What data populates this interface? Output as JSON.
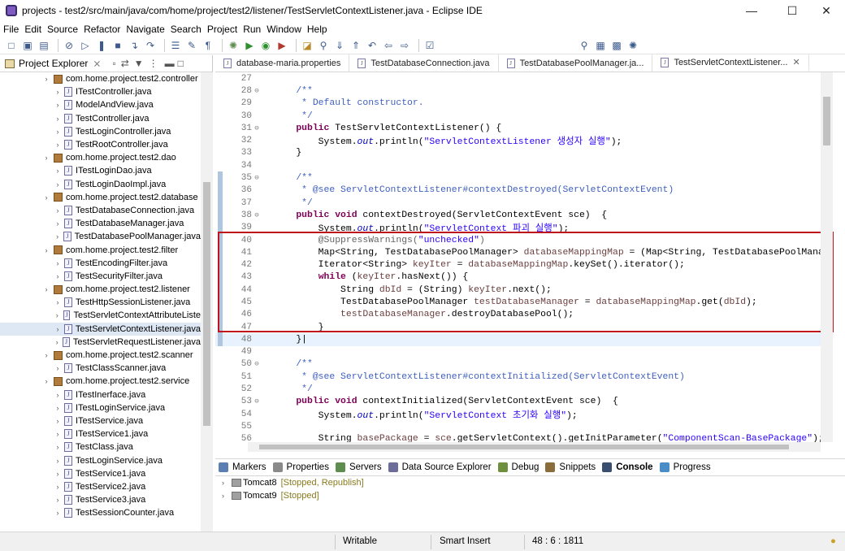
{
  "window": {
    "title": "projects - test2/src/main/java/com/home/project/test2/listener/TestServletContextListener.java - Eclipse IDE"
  },
  "menu": [
    "File",
    "Edit",
    "Source",
    "Refactor",
    "Navigate",
    "Search",
    "Project",
    "Run",
    "Window",
    "Help"
  ],
  "explorer": {
    "title": "Project Explorer",
    "rows": [
      {
        "label": "com.home.project.test2.controller",
        "type": "package",
        "level": 0
      },
      {
        "label": "ITestController.java",
        "type": "file",
        "level": 1
      },
      {
        "label": "ModelAndView.java",
        "type": "file",
        "level": 1
      },
      {
        "label": "TestController.java",
        "type": "file",
        "level": 1
      },
      {
        "label": "TestLoginController.java",
        "type": "file",
        "level": 1
      },
      {
        "label": "TestRootController.java",
        "type": "file",
        "level": 1
      },
      {
        "label": "com.home.project.test2.dao",
        "type": "package",
        "level": 0
      },
      {
        "label": "ITestLoginDao.java",
        "type": "file",
        "level": 1
      },
      {
        "label": "TestLoginDaoImpl.java",
        "type": "file",
        "level": 1
      },
      {
        "label": "com.home.project.test2.database",
        "type": "package",
        "level": 0
      },
      {
        "label": "TestDatabaseConnection.java",
        "type": "file",
        "level": 1
      },
      {
        "label": "TestDatabaseManager.java",
        "type": "file",
        "level": 1
      },
      {
        "label": "TestDatabasePoolManager.java",
        "type": "file",
        "level": 1
      },
      {
        "label": "com.home.project.test2.filter",
        "type": "package",
        "level": 0
      },
      {
        "label": "TestEncodingFilter.java",
        "type": "file",
        "level": 1
      },
      {
        "label": "TestSecurityFilter.java",
        "type": "file",
        "level": 1
      },
      {
        "label": "com.home.project.test2.listener",
        "type": "package",
        "level": 0
      },
      {
        "label": "TestHttpSessionListener.java",
        "type": "file",
        "level": 1
      },
      {
        "label": "TestServletContextAttributeListe",
        "type": "file",
        "level": 1
      },
      {
        "label": "TestServletContextListener.java",
        "type": "file",
        "level": 1,
        "selected": true
      },
      {
        "label": "TestServletRequestListener.java",
        "type": "file",
        "level": 1
      },
      {
        "label": "com.home.project.test2.scanner",
        "type": "package",
        "level": 0
      },
      {
        "label": "TestClassScanner.java",
        "type": "file",
        "level": 1
      },
      {
        "label": "com.home.project.test2.service",
        "type": "package",
        "level": 0
      },
      {
        "label": "ITestInerface.java",
        "type": "file",
        "level": 1
      },
      {
        "label": "ITestLoginService.java",
        "type": "file",
        "level": 1
      },
      {
        "label": "ITestService.java",
        "type": "file",
        "level": 1
      },
      {
        "label": "ITestService1.java",
        "type": "file",
        "level": 1
      },
      {
        "label": "TestClass.java",
        "type": "file",
        "level": 1
      },
      {
        "label": "TestLoginService.java",
        "type": "file",
        "level": 1
      },
      {
        "label": "TestService1.java",
        "type": "file",
        "level": 1
      },
      {
        "label": "TestService2.java",
        "type": "file",
        "level": 1
      },
      {
        "label": "TestService3.java",
        "type": "file",
        "level": 1
      },
      {
        "label": "TestSessionCounter.java",
        "type": "file",
        "level": 1
      }
    ]
  },
  "editor_tabs": [
    {
      "label": "database-maria.properties",
      "active": false
    },
    {
      "label": "TestDatabaseConnection.java",
      "active": false
    },
    {
      "label": "TestDatabasePoolManager.ja...",
      "active": false
    },
    {
      "label": "TestServletContextListener...",
      "active": true
    }
  ],
  "code_lines": [
    {
      "n": "27",
      "marker": false,
      "fold": "",
      "segs": []
    },
    {
      "n": "28",
      "marker": false,
      "fold": "⊖",
      "segs": [
        {
          "c": "cm",
          "t": "    /**"
        }
      ]
    },
    {
      "n": "29",
      "marker": false,
      "fold": "",
      "segs": [
        {
          "c": "cm",
          "t": "     * Default constructor."
        }
      ]
    },
    {
      "n": "30",
      "marker": false,
      "fold": "",
      "segs": [
        {
          "c": "cm",
          "t": "     */"
        }
      ]
    },
    {
      "n": "31",
      "marker": false,
      "fold": "⊖",
      "segs": [
        {
          "c": "",
          "t": "    "
        },
        {
          "c": "kw",
          "t": "public"
        },
        {
          "c": "",
          "t": " TestServletContextListener() {"
        }
      ]
    },
    {
      "n": "32",
      "marker": false,
      "fold": "",
      "segs": [
        {
          "c": "",
          "t": "        System."
        },
        {
          "c": "fi",
          "t": "out"
        },
        {
          "c": "",
          "t": ".println("
        },
        {
          "c": "st",
          "t": "\"ServletContextListener 생성자 실행\""
        },
        {
          "c": "",
          "t": ");"
        }
      ]
    },
    {
      "n": "33",
      "marker": false,
      "fold": "",
      "segs": [
        {
          "c": "",
          "t": "    }"
        }
      ]
    },
    {
      "n": "34",
      "marker": false,
      "fold": "",
      "segs": []
    },
    {
      "n": "35",
      "marker": true,
      "fold": "⊖",
      "segs": [
        {
          "c": "cm",
          "t": "    /**"
        }
      ]
    },
    {
      "n": "36",
      "marker": true,
      "fold": "",
      "segs": [
        {
          "c": "cm",
          "t": "     * @see ServletContextListener#contextDestroyed(ServletContextEvent)"
        }
      ]
    },
    {
      "n": "37",
      "marker": true,
      "fold": "",
      "segs": [
        {
          "c": "cm",
          "t": "     */"
        }
      ]
    },
    {
      "n": "38",
      "marker": true,
      "fold": "⊖",
      "segs": [
        {
          "c": "",
          "t": "    "
        },
        {
          "c": "kw",
          "t": "public void"
        },
        {
          "c": "",
          "t": " contextDestroyed(ServletContextEvent sce)  {"
        }
      ]
    },
    {
      "n": "39",
      "marker": true,
      "fold": "",
      "segs": [
        {
          "c": "",
          "t": "        System."
        },
        {
          "c": "fi",
          "t": "out"
        },
        {
          "c": "",
          "t": ".println("
        },
        {
          "c": "st",
          "t": "\"ServletContext 파괴 실행\""
        },
        {
          "c": "",
          "t": ");"
        }
      ]
    },
    {
      "n": "40",
      "marker": true,
      "fold": "",
      "segs": [
        {
          "c": "an",
          "t": "        @SuppressWarnings("
        },
        {
          "c": "st",
          "t": "\"unchecked\""
        },
        {
          "c": "an",
          "t": ")"
        }
      ]
    },
    {
      "n": "41",
      "marker": true,
      "fold": "",
      "segs": [
        {
          "c": "",
          "t": "        Map<String, TestDatabasePoolManager> "
        },
        {
          "c": "lv",
          "t": "databaseMappingMap"
        },
        {
          "c": "",
          "t": " = (Map<String, TestDatabasePoolManager>)s"
        }
      ]
    },
    {
      "n": "42",
      "marker": true,
      "fold": "",
      "segs": [
        {
          "c": "",
          "t": "        Iterator<String> "
        },
        {
          "c": "lv",
          "t": "keyIter"
        },
        {
          "c": "",
          "t": " = "
        },
        {
          "c": "lv",
          "t": "databaseMappingMap"
        },
        {
          "c": "",
          "t": ".keySet().iterator();"
        }
      ]
    },
    {
      "n": "43",
      "marker": true,
      "fold": "",
      "segs": [
        {
          "c": "",
          "t": "        "
        },
        {
          "c": "kw",
          "t": "while"
        },
        {
          "c": "",
          "t": " ("
        },
        {
          "c": "lv",
          "t": "keyIter"
        },
        {
          "c": "",
          "t": ".hasNext()) {"
        }
      ]
    },
    {
      "n": "44",
      "marker": true,
      "fold": "",
      "segs": [
        {
          "c": "",
          "t": "            String "
        },
        {
          "c": "lv",
          "t": "dbId"
        },
        {
          "c": "",
          "t": " = (String) "
        },
        {
          "c": "lv",
          "t": "keyIter"
        },
        {
          "c": "",
          "t": ".next();"
        }
      ]
    },
    {
      "n": "45",
      "marker": true,
      "fold": "",
      "segs": [
        {
          "c": "",
          "t": "            TestDatabasePoolManager "
        },
        {
          "c": "lv",
          "t": "testDatabaseManager"
        },
        {
          "c": "",
          "t": " = "
        },
        {
          "c": "lv",
          "t": "databaseMappingMap"
        },
        {
          "c": "",
          "t": ".get("
        },
        {
          "c": "lv",
          "t": "dbId"
        },
        {
          "c": "",
          "t": ");"
        }
      ]
    },
    {
      "n": "46",
      "marker": true,
      "fold": "",
      "segs": [
        {
          "c": "",
          "t": "            "
        },
        {
          "c": "lv",
          "t": "testDatabaseManager"
        },
        {
          "c": "",
          "t": ".destroyDatabasePool();"
        }
      ]
    },
    {
      "n": "47",
      "marker": true,
      "fold": "",
      "segs": [
        {
          "c": "",
          "t": "        }"
        }
      ]
    },
    {
      "n": "48",
      "marker": true,
      "fold": "",
      "cur": true,
      "segs": [
        {
          "c": "",
          "t": "    }|"
        }
      ]
    },
    {
      "n": "49",
      "marker": false,
      "fold": "",
      "segs": []
    },
    {
      "n": "50",
      "marker": false,
      "fold": "⊖",
      "segs": [
        {
          "c": "cm",
          "t": "    /**"
        }
      ]
    },
    {
      "n": "51",
      "marker": false,
      "fold": "",
      "segs": [
        {
          "c": "cm",
          "t": "     * @see ServletContextListener#contextInitialized(ServletContextEvent)"
        }
      ]
    },
    {
      "n": "52",
      "marker": false,
      "fold": "",
      "segs": [
        {
          "c": "cm",
          "t": "     */"
        }
      ]
    },
    {
      "n": "53",
      "marker": false,
      "fold": "⊖",
      "segs": [
        {
          "c": "",
          "t": "    "
        },
        {
          "c": "kw",
          "t": "public void"
        },
        {
          "c": "",
          "t": " contextInitialized(ServletContextEvent sce)  {"
        }
      ]
    },
    {
      "n": "54",
      "marker": false,
      "fold": "",
      "segs": [
        {
          "c": "",
          "t": "        System."
        },
        {
          "c": "fi",
          "t": "out"
        },
        {
          "c": "",
          "t": ".println("
        },
        {
          "c": "st",
          "t": "\"ServletContext 초기화 실행\""
        },
        {
          "c": "",
          "t": ");"
        }
      ]
    },
    {
      "n": "55",
      "marker": false,
      "fold": "",
      "segs": []
    },
    {
      "n": "56",
      "marker": false,
      "fold": "",
      "segs": [
        {
          "c": "",
          "t": "        String "
        },
        {
          "c": "lv",
          "t": "basePackage"
        },
        {
          "c": "",
          "t": " = "
        },
        {
          "c": "lv",
          "t": "sce"
        },
        {
          "c": "",
          "t": ".getServletContext().getInitParameter("
        },
        {
          "c": "st",
          "t": "\"ComponentScan-BasePackage\""
        },
        {
          "c": "",
          "t": ");"
        }
      ]
    }
  ],
  "bottom_tabs": [
    {
      "label": "Markers",
      "icon_color": "#5b7fb3",
      "active": false
    },
    {
      "label": "Properties",
      "icon_color": "#8a8a8a",
      "active": false
    },
    {
      "label": "Servers",
      "icon_color": "#5f8c4f",
      "active": false
    },
    {
      "label": "Data Source Explorer",
      "icon_color": "#6d6d9a",
      "active": false
    },
    {
      "label": "Debug",
      "icon_color": "#6f8f3f",
      "active": false
    },
    {
      "label": "Snippets",
      "icon_color": "#8a6d3b",
      "active": false
    },
    {
      "label": "Console",
      "icon_color": "#3a4f70",
      "active": true
    },
    {
      "label": "Progress",
      "icon_color": "#4a8cc5",
      "active": false
    }
  ],
  "servers": [
    {
      "name": "Tomcat8",
      "state": "[Stopped, Republish]"
    },
    {
      "name": "Tomcat9",
      "state": "[Stopped]"
    }
  ],
  "status": {
    "writable": "Writable",
    "insert_mode": "Smart Insert",
    "position": "48 : 6 : 1811"
  }
}
